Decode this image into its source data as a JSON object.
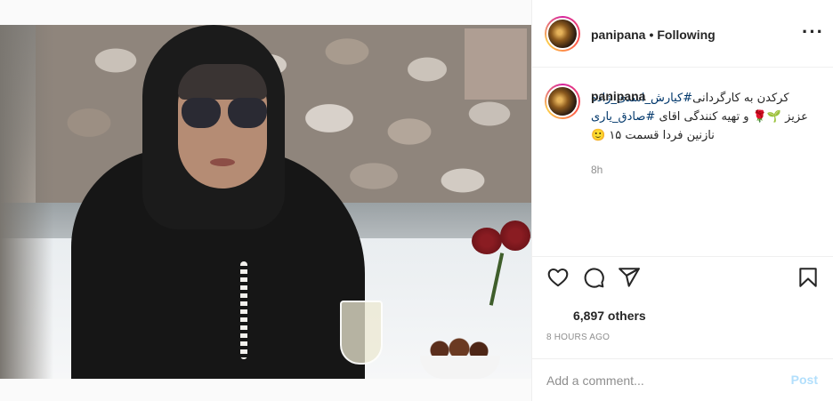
{
  "post": {
    "username": "panipana",
    "separator": "•",
    "follow_status": "Following",
    "more_icon": "ellipsis-icon"
  },
  "caption": {
    "username": "panipana",
    "line1_prefix": "کرکدن به کارگردانی",
    "tag1": "#کیارش_اسدی_زاده",
    "line2_mid": " عزیز 🌱🌹 و تهیه کنندگی اقای ",
    "tag2": "#صادق_یاری",
    "line3": " نازنین فردا قسمت ۱۵ 🙂",
    "relative_time": "8h"
  },
  "actions": {
    "like_icon": "heart-icon",
    "comment_icon": "comment-icon",
    "share_icon": "paper-plane-icon",
    "save_icon": "bookmark-icon"
  },
  "likes_text": "6,897 others",
  "posted_text": "8 HOURS AGO",
  "comment": {
    "placeholder": "Add a comment...",
    "post_label": "Post"
  },
  "colors": {
    "link": "#00376b",
    "post_disabled": "#b2dffc",
    "muted": "#8e8e8e",
    "border": "#efefef"
  }
}
